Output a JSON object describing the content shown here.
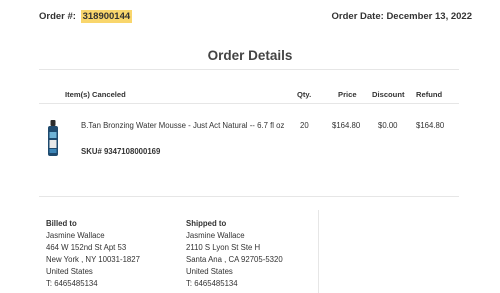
{
  "order": {
    "number_label": "Order #:",
    "number": "318900144",
    "date_label": "Order Date:",
    "date": "December 13, 2022"
  },
  "title": "Order Details",
  "table": {
    "headers": {
      "items": "Item(s) Canceled",
      "qty": "Qty.",
      "price": "Price",
      "discount": "Discount",
      "refund": "Refund"
    },
    "rows": [
      {
        "name": "B.Tan Bronzing Water Mousse - Just Act Natural -- 6.7 fl oz",
        "sku": "SKU# 9347108000169",
        "qty": "20",
        "price": "$164.80",
        "discount": "$0.00",
        "refund": "$164.80",
        "image_icon": "product-bottle"
      }
    ]
  },
  "billed_to": {
    "label": "Billed to",
    "name": "Jasmine Wallace",
    "street": "464 W 152nd St Apt 53",
    "city": "New York , NY 10031-1827",
    "country": "United States",
    "phone": "T: 6465485134"
  },
  "shipped_to": {
    "label": "Shipped to",
    "name": "Jasmine Wallace",
    "street": "2110 S Lyon St Ste H",
    "city": "Santa Ana , CA 92705-5320",
    "country": "United States",
    "phone": "T: 6465485134"
  },
  "colors": {
    "highlight": "#f9d66c",
    "divider": "#e6e6e6",
    "text": "#333333"
  }
}
